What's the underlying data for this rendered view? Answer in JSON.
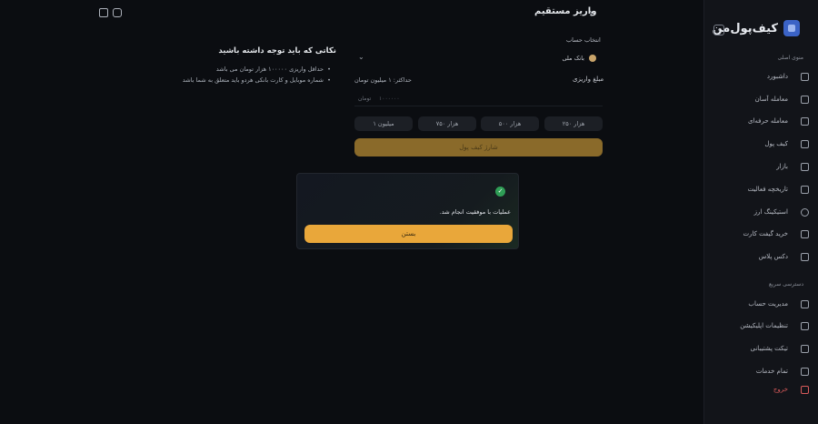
{
  "header": {
    "title": "واریز مستقیم",
    "back_icon": "chevron-right-icon"
  },
  "sidebar": {
    "brand": "کیف‌پول‌من",
    "main_menu_title": "منوی اصلی",
    "main_items": [
      {
        "label": "داشبورد",
        "icon": "grid-icon"
      },
      {
        "label": "معامله آسان",
        "icon": "chart-icon"
      },
      {
        "label": "معامله حرفه‌ای",
        "icon": "pro-trade-icon"
      },
      {
        "label": "کیف پول",
        "icon": "wallet-icon"
      },
      {
        "label": "بازار",
        "icon": "market-icon"
      },
      {
        "label": "تاریخچه فعالیت",
        "icon": "calendar-icon"
      },
      {
        "label": "استیکینگ ارز",
        "icon": "staking-icon"
      },
      {
        "label": "خرید گیفت کارت",
        "icon": "gift-icon"
      },
      {
        "label": "دکس پلاس",
        "icon": "dex-icon"
      }
    ],
    "quick_access_title": "دسترسی سریع",
    "quick_items": [
      {
        "label": "مدیریت حساب",
        "icon": "account-icon"
      },
      {
        "label": "تنظیمات اپلیکیشن",
        "icon": "settings-icon"
      },
      {
        "label": "تیکت پشتیبانی",
        "icon": "ticket-icon"
      },
      {
        "label": "تمام خدمات",
        "icon": "services-icon"
      },
      {
        "label": "خروج",
        "icon": "logout-icon"
      }
    ]
  },
  "notes": {
    "title": "نکاتی که باید توجه داشته باشید",
    "items": [
      "حداقل واریزی ۱۰۰۰۰۰ هزار تومان می باشد",
      "شماره موبایل و کارت بانکی هردو باید متعلق به شما باشد"
    ]
  },
  "form": {
    "account_label": "انتخاب حساب",
    "bank_name": "بانک ملی",
    "amount_label": "مبلغ واریزی",
    "max_hint": "حداکثر: ۱ میلیون تومان",
    "amount_placeholder": "۱۰۰۰۰۰۰",
    "amount_unit": "تومان",
    "presets": [
      "۲۵۰ هزار",
      "۵۰۰ هزار",
      "۷۵۰ هزار",
      "۱ میلیون"
    ],
    "submit_label": "شارژ کیف پول"
  },
  "modal": {
    "message": "عملیات با موفقیت انجام شد.",
    "close_label": "بستن",
    "icon": "check-circle-icon"
  },
  "colors": {
    "accent": "#e9a73a",
    "success": "#2f9e56",
    "danger": "#d85a5a",
    "background": "#0b0d11"
  }
}
